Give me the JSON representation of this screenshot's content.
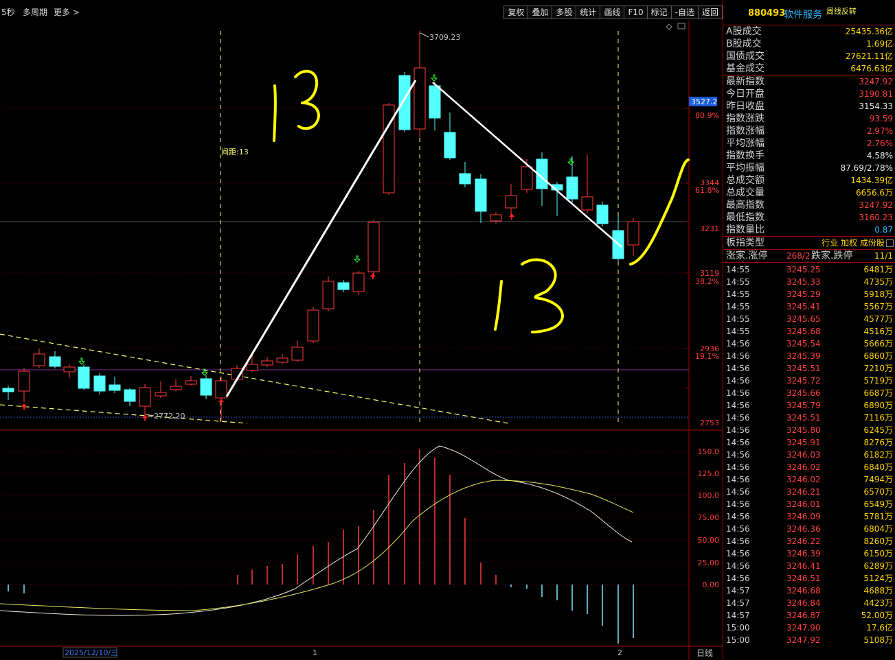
{
  "toolbar": {
    "period": "5秒",
    "multi_period": "多周期",
    "more": "更多 >",
    "buttons": [
      "复权",
      "叠加",
      "多股",
      "统计",
      "画线",
      "F10",
      "标记",
      "-自选",
      "返回"
    ]
  },
  "chart": {
    "price_labels": [
      "3527.2",
      "3344",
      "3231",
      "3119",
      "2936",
      "2753"
    ],
    "pct_labels": [
      "80.9%",
      "61.8%",
      "38.2%",
      "19.1%"
    ],
    "high_label": "3709.23",
    "low_label": "2772.20",
    "spacing_label": "间距:13",
    "handwriting": [
      "13",
      "13"
    ],
    "ind_labels": [
      "150.0",
      "125.0",
      "100.0",
      "75.00",
      "50.00",
      "25.00",
      "0.00"
    ],
    "date_label": "2025/12/10/三",
    "x_marks": [
      "1",
      "2"
    ],
    "bottom_right": "日线",
    "colors": {
      "up": "#ff3c3c",
      "down": "#54ffff",
      "grid": "#a00000",
      "dash": "#ffff66"
    }
  },
  "panel": {
    "code": "880493",
    "name": "软件服务",
    "tag": "周线反转",
    "stats1": [
      {
        "k": "A股成交",
        "v": "25435.36亿",
        "c": "yel"
      },
      {
        "k": "B股成交",
        "v": "1.69亿",
        "c": "yel"
      },
      {
        "k": "国债成交",
        "v": "27621.11亿",
        "c": "yel"
      },
      {
        "k": "基金成交",
        "v": "6476.63亿",
        "c": "yel"
      }
    ],
    "stats2": [
      {
        "k": "最新指数",
        "v": "3247.92",
        "c": "red"
      },
      {
        "k": "今日开盘",
        "v": "3190.81",
        "c": "red"
      },
      {
        "k": "昨日收盘",
        "v": "3154.33",
        "c": "wht"
      },
      {
        "k": "指数涨跌",
        "v": "93.59",
        "c": "red"
      },
      {
        "k": "指数涨幅",
        "v": "2.97%",
        "c": "red"
      },
      {
        "k": "平均涨幅",
        "v": "2.76%",
        "c": "red"
      },
      {
        "k": "指数换手",
        "v": "4.58%",
        "c": "wht"
      },
      {
        "k": "平均振幅",
        "v": "87.69/2.78%",
        "c": "wht"
      },
      {
        "k": "总成交额",
        "v": "1434.39亿",
        "c": "yel"
      },
      {
        "k": "总成交量",
        "v": "6656.6万",
        "c": "yel"
      },
      {
        "k": "最高指数",
        "v": "3247.92",
        "c": "red"
      },
      {
        "k": "最低指数",
        "v": "3160.23",
        "c": "red"
      },
      {
        "k": "指数量比",
        "v": "0.87",
        "c": "blu"
      }
    ],
    "board_type": {
      "k": "板指类型",
      "v": "行业 加权 成份股"
    },
    "rise_limit": {
      "k": "涨家.涨停",
      "v": "268/2",
      "k2": "跌家.跌停",
      "v2": "11/1"
    },
    "ticks": [
      [
        "14:55",
        "3245.25",
        "6481万"
      ],
      [
        "14:55",
        "3245.33",
        "4735万"
      ],
      [
        "14:55",
        "3245.29",
        "5918万"
      ],
      [
        "14:55",
        "3245.41",
        "5567万"
      ],
      [
        "14:55",
        "3245.65",
        "4577万"
      ],
      [
        "14:55",
        "3245.68",
        "4516万"
      ],
      [
        "14:56",
        "3245.54",
        "5666万"
      ],
      [
        "14:56",
        "3245.39",
        "6860万"
      ],
      [
        "14:56",
        "3245.51",
        "7210万"
      ],
      [
        "14:56",
        "3245.72",
        "5719万"
      ],
      [
        "14:56",
        "3245.66",
        "6687万"
      ],
      [
        "14:56",
        "3245.79",
        "6890万"
      ],
      [
        "14:56",
        "3245.51",
        "7116万"
      ],
      [
        "14:56",
        "3245.80",
        "6245万"
      ],
      [
        "14:56",
        "3245.91",
        "8276万"
      ],
      [
        "14:56",
        "3246.03",
        "6182万"
      ],
      [
        "14:56",
        "3246.02",
        "6840万"
      ],
      [
        "14:56",
        "3246.02",
        "7494万"
      ],
      [
        "14:56",
        "3246.21",
        "6570万"
      ],
      [
        "14:56",
        "3246.01",
        "6549万"
      ],
      [
        "14:56",
        "3246.09",
        "5781万"
      ],
      [
        "14:56",
        "3246.36",
        "6804万"
      ],
      [
        "14:56",
        "3246.22",
        "8260万"
      ],
      [
        "14:56",
        "3246.39",
        "6150万"
      ],
      [
        "14:56",
        "3246.41",
        "6289万"
      ],
      [
        "14:56",
        "3246.51",
        "5124万"
      ],
      [
        "14:57",
        "3246.68",
        "4688万"
      ],
      [
        "14:57",
        "3246.84",
        "4423万"
      ],
      [
        "14:57",
        "3246.87",
        "52.00万"
      ],
      [
        "15:00",
        "3247.90",
        "17.6亿"
      ],
      [
        "15:00",
        "3247.92",
        "5108万"
      ]
    ]
  }
}
